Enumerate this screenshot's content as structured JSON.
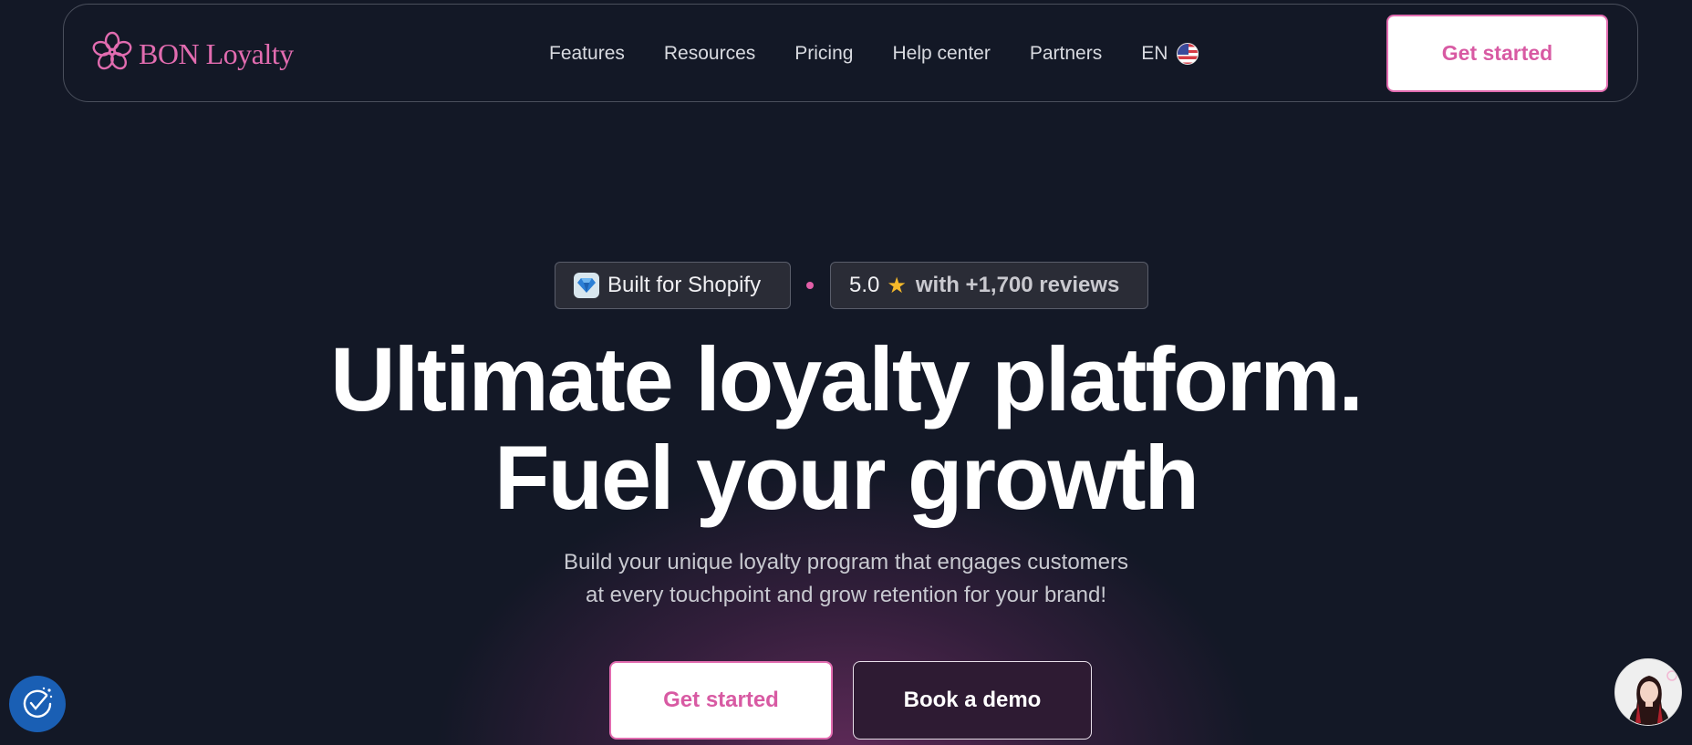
{
  "nav": {
    "logo_text": "BON Loyalty",
    "links": [
      "Features",
      "Resources",
      "Pricing",
      "Help center",
      "Partners"
    ],
    "language": "EN",
    "cta": "Get started"
  },
  "badges": {
    "shopify": "Built for Shopify",
    "rating": "5.0",
    "reviews": "with +1,700 reviews"
  },
  "hero": {
    "headline_line1": "Ultimate loyalty platform.",
    "headline_line2": "Fuel your growth",
    "subtitle_line1": "Build your unique loyalty program that engages customers",
    "subtitle_line2": "at every touchpoint and grow retention for your brand!",
    "cta_primary": "Get started",
    "cta_secondary": "Book a demo"
  },
  "icons": {
    "logo": "flower-icon",
    "flag": "us-flag-icon",
    "shopify": "diamond-icon",
    "star": "star-icon",
    "cookie": "cookie-consent-icon",
    "chat": "chat-avatar"
  },
  "colors": {
    "background": "#131826",
    "accent": "#e26cb0",
    "star": "#f5b92a",
    "cookie_button": "#1a5fb4"
  }
}
